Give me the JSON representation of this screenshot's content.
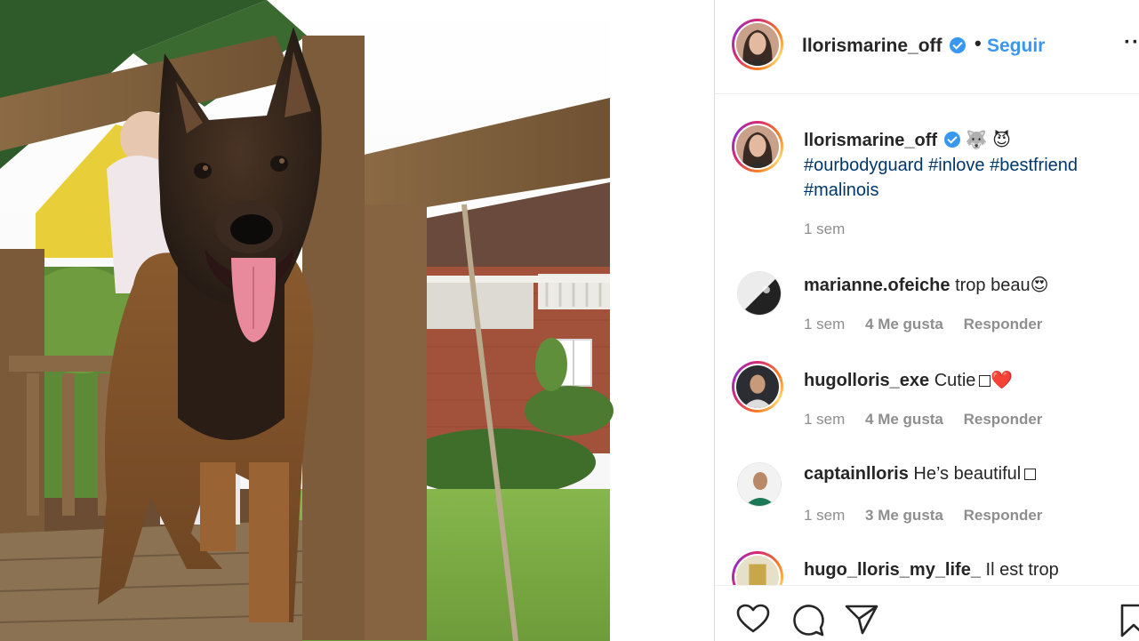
{
  "header": {
    "username": "llorismarine_off",
    "separator": "•",
    "follow_label": "Seguir",
    "more_label": "··"
  },
  "caption": {
    "username": "llorismarine_off",
    "emojis": "🐺 😈",
    "hashtags": [
      "#ourbodyguard",
      "#inlove",
      "#bestfriend",
      "#malinois"
    ],
    "time": "1 sem"
  },
  "comments": [
    {
      "username": "marianne.ofeiche",
      "text": "trop beau😍",
      "time": "1 sem",
      "likes": "4 Me gusta",
      "reply": "Responder"
    },
    {
      "username": "hugolloris_exe",
      "text": "Cutie",
      "suffix": "❤️",
      "time": "1 sem",
      "likes": "4 Me gusta",
      "reply": "Responder"
    },
    {
      "username": "captainlloris",
      "text": "He’s beautiful",
      "time": "1 sem",
      "likes": "3 Me gusta",
      "reply": "Responder"
    },
    {
      "username": "hugo_lloris_my_life_",
      "text": "Il est trop"
    }
  ],
  "actions": {
    "like_icon": "heart-icon",
    "comment_icon": "comment-icon",
    "share_icon": "share-icon",
    "save_icon": "bookmark-icon"
  },
  "colors": {
    "accent": "#3897f0",
    "hashtag": "#00376b",
    "muted": "#8e8e8e"
  }
}
